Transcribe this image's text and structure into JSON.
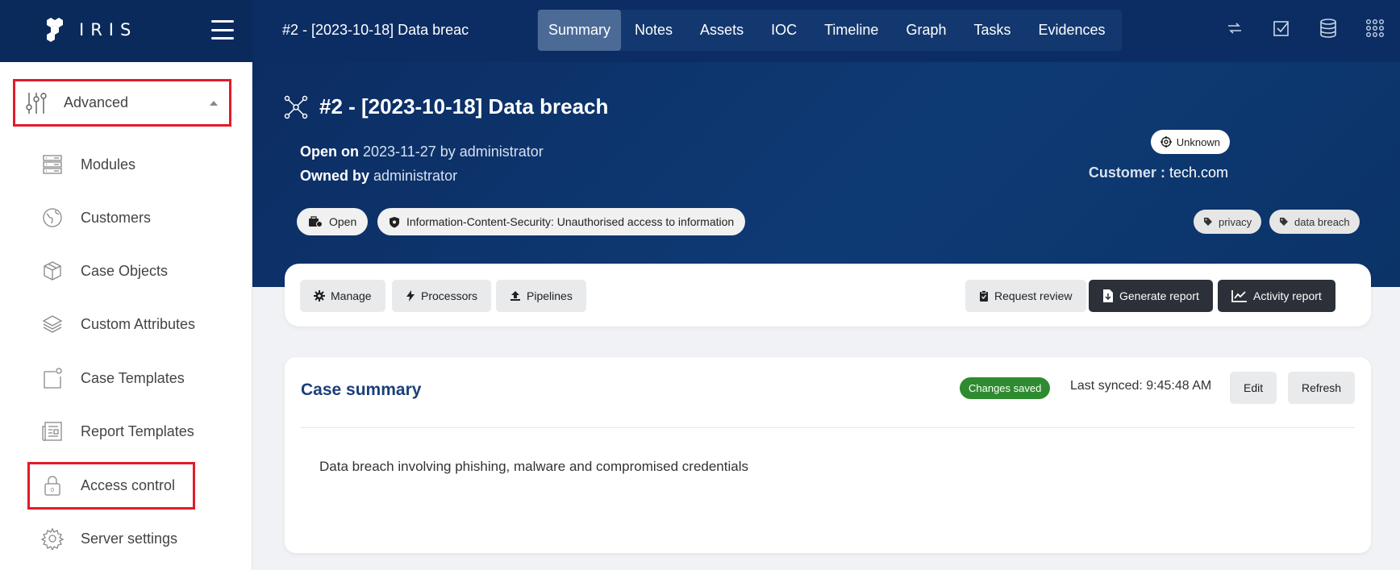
{
  "app": {
    "logo_text": "IRIS"
  },
  "topbar": {
    "case_title": "#2 - [2023-10-18] Data breac",
    "tabs": [
      {
        "label": "Summary",
        "active": true
      },
      {
        "label": "Notes"
      },
      {
        "label": "Assets"
      },
      {
        "label": "IOC"
      },
      {
        "label": "Timeline"
      },
      {
        "label": "Graph"
      },
      {
        "label": "Tasks"
      },
      {
        "label": "Evidences"
      }
    ],
    "icons": [
      "sync-icon",
      "checkbox-icon",
      "database-icon",
      "apps-grid-icon"
    ]
  },
  "sidebar": {
    "section": {
      "label": "Advanced",
      "icon": "sliders-icon"
    },
    "items": [
      {
        "label": "Modules",
        "icon": "server-icon"
      },
      {
        "label": "Customers",
        "icon": "globe-icon"
      },
      {
        "label": "Case Objects",
        "icon": "box-icon"
      },
      {
        "label": "Custom Attributes",
        "icon": "layers-icon"
      },
      {
        "label": "Case Templates",
        "icon": "template-icon"
      },
      {
        "label": "Report Templates",
        "icon": "newspaper-icon"
      },
      {
        "label": "Access control",
        "icon": "lock-icon"
      },
      {
        "label": "Server settings",
        "icon": "gear-icon"
      }
    ]
  },
  "case": {
    "title": "#2 - [2023-10-18] Data breach",
    "open_on_label": "Open on",
    "open_on_value": "2023-11-27 by administrator",
    "owned_by_label": "Owned by",
    "owned_by_value": "administrator",
    "status": "Open",
    "classification": "Information-Content-Security: Unauthorised access to information",
    "severity": "Unknown",
    "customer_label": "Customer",
    "customer_sep": ":",
    "customer_value": "tech.com",
    "tags": [
      "privacy",
      "data breach"
    ]
  },
  "actions": {
    "manage": "Manage",
    "processors": "Processors",
    "pipelines": "Pipelines",
    "request_review": "Request review",
    "generate_report": "Generate report",
    "activity_report": "Activity report"
  },
  "summary": {
    "title": "Case summary",
    "saved_badge": "Changes saved",
    "last_synced": "Last synced: 9:45:48 AM",
    "edit": "Edit",
    "refresh": "Refresh",
    "text": "Data breach involving phishing, malware and compromised credentials"
  },
  "colors": {
    "topbar": "#0c2d63",
    "highlight_box": "#e11b2a",
    "saved_badge": "#2e8b2f",
    "dark_button": "#2c3038",
    "summary_title": "#1b3f7a"
  }
}
